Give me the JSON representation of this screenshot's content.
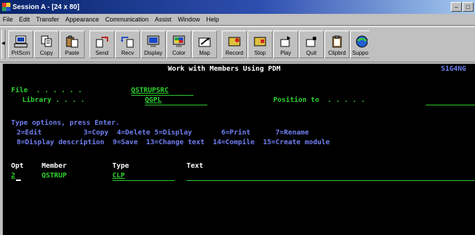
{
  "window": {
    "title": "Session A - [24 x 80]"
  },
  "menu": [
    {
      "label": "File",
      "underline": "F"
    },
    {
      "label": "Edit",
      "underline": "E"
    },
    {
      "label": "Transfer",
      "underline": "T"
    },
    {
      "label": "Appearance",
      "underline": "A"
    },
    {
      "label": "Communication",
      "underline": "C"
    },
    {
      "label": "Assist",
      "underline": "s"
    },
    {
      "label": "Window",
      "underline": "W"
    },
    {
      "label": "Help",
      "underline": "H"
    }
  ],
  "toolbar": [
    {
      "label": "PrtScrn",
      "icon": "printer-screen-icon"
    },
    {
      "label": "Copy",
      "icon": "copy-icon"
    },
    {
      "label": "Paste",
      "icon": "paste-icon"
    },
    {
      "label": "Send",
      "icon": "send-icon"
    },
    {
      "label": "Recv",
      "icon": "receive-icon"
    },
    {
      "label": "Display",
      "icon": "display-icon"
    },
    {
      "label": "Color",
      "icon": "color-icon"
    },
    {
      "label": "Map",
      "icon": "map-icon"
    },
    {
      "label": "Record",
      "icon": "record-icon"
    },
    {
      "label": "Stop",
      "icon": "stop-icon"
    },
    {
      "label": "Play",
      "icon": "play-icon"
    },
    {
      "label": "Quit",
      "icon": "quit-icon"
    },
    {
      "label": "Clipbrd",
      "icon": "clipboard-icon"
    },
    {
      "label": "Suppo",
      "icon": "support-icon"
    }
  ],
  "screen": {
    "title": "Work with Members Using PDM",
    "system": "S1G4NG",
    "file_label": "File  . . . . . .",
    "file_value": "QSTRUPSRC",
    "library_label": "Library . . . .",
    "library_value": "QGPL",
    "position_label": "Position to  . . . . .",
    "options_heading": "Type options, press Enter.",
    "options_line1": "2=Edit          3=Copy  4=Delete 5=Display       6=Print      7=Rename",
    "options_line2": "8=Display description  9=Save  13=Change text  14=Compile  15=Create module",
    "col_opt": "Opt",
    "col_member": "Member",
    "col_type": "Type",
    "col_text": "Text",
    "row_opt": "2",
    "row_member": "QSTRUP",
    "row_type": "CLP"
  }
}
